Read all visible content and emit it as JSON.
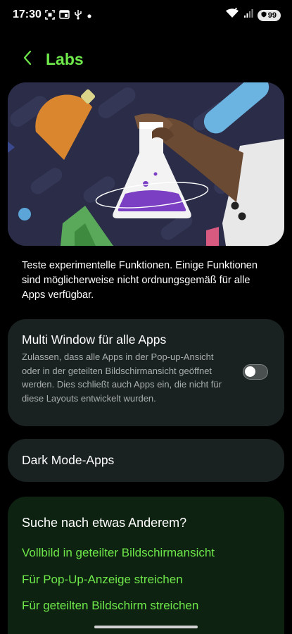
{
  "status_bar": {
    "time": "17:30",
    "left_icons": [
      "screenshot-icon",
      "cast-icon",
      "usb-icon",
      "notification-dot-icon"
    ],
    "right_icons": [
      "wifi-icon",
      "signal-icon"
    ],
    "battery": "99"
  },
  "header": {
    "title": "Labs",
    "back_icon": "chevron-left-icon"
  },
  "banner": {
    "illustration": "labs-flask-illustration"
  },
  "description": "Teste experimentelle Funktionen. Einige Funktionen sind möglicherweise nicht ordnungsgemäß für alle Apps verfügbar.",
  "multi_window": {
    "title": "Multi Window für alle Apps",
    "subtitle": "Zulassen, dass alle Apps in der Pop-up-Ansicht oder in der geteilten Bildschirmansicht geöffnet werden. Dies schließt auch Apps ein, die nicht für diese Layouts entwickelt wurden.",
    "toggle_on": false
  },
  "dark_mode": {
    "title": "Dark Mode-Apps"
  },
  "search_more": {
    "title": "Suche nach etwas Anderem?",
    "links": [
      "Vollbild in geteilter Bildschirmansicht",
      "Für Pop-Up-Anzeige streichen",
      "Für geteilten Bildschirm streichen"
    ]
  },
  "colors": {
    "accent": "#6ee84a",
    "background": "#000000",
    "card": "#1a2121",
    "search_card": "#0d2210"
  }
}
